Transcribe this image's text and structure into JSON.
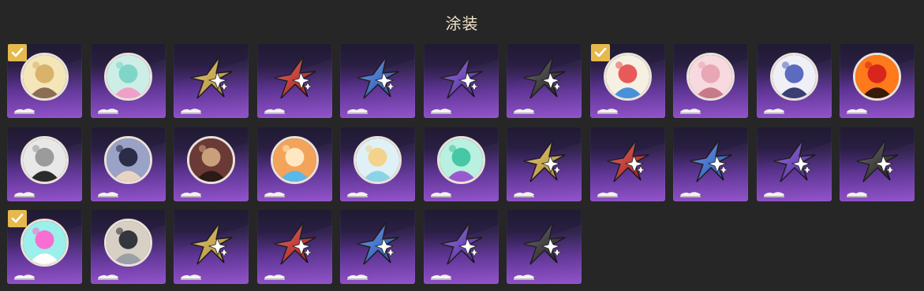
{
  "page": {
    "title": "涂装"
  },
  "colors": {
    "background": "#262626",
    "title": "#f0e3c8",
    "check_badge": "#e6b94c",
    "gold": "#e8b93f",
    "red": "#e0261f",
    "blue": "#2f72ea",
    "purple": "#6a34d4",
    "black": "#2a2a2a"
  },
  "skins": [
    {
      "name": "skin-avatar-girl-sketch",
      "kind": "avatar",
      "palette": [
        "#f4e6b8",
        "#d9b36b",
        "#8a6d53"
      ],
      "equipped": true
    },
    {
      "name": "skin-avatar-teal-swirl",
      "kind": "avatar",
      "palette": [
        "#cdeee6",
        "#7fd6c8",
        "#f0a0c8"
      ],
      "equipped": false
    },
    {
      "name": "skin-star-gold",
      "kind": "star",
      "color": "#e8b93f",
      "equipped": false
    },
    {
      "name": "skin-star-red",
      "kind": "star",
      "color": "#e0261f",
      "equipped": false
    },
    {
      "name": "skin-star-blue",
      "kind": "star",
      "color": "#2f72ea",
      "equipped": false
    },
    {
      "name": "skin-star-purple",
      "kind": "star",
      "color": "#6a34d4",
      "equipped": false
    },
    {
      "name": "skin-star-black",
      "kind": "star",
      "color": "#2a2a2a",
      "equipped": false
    },
    {
      "name": "skin-avatar-sticker-collage",
      "kind": "avatar",
      "palette": [
        "#f6f0e2",
        "#e85a5a",
        "#4a90d9"
      ],
      "equipped": true
    },
    {
      "name": "skin-avatar-pink-sketch",
      "kind": "avatar",
      "palette": [
        "#f7d9df",
        "#e8a7b4",
        "#c77a8a"
      ],
      "equipped": false
    },
    {
      "name": "skin-avatar-emblem-crest",
      "kind": "avatar",
      "palette": [
        "#eef0f6",
        "#5c6bc0",
        "#3a3f73"
      ],
      "equipped": false
    },
    {
      "name": "skin-avatar-red-creature",
      "kind": "avatar",
      "palette": [
        "#ff7a1a",
        "#d8261c",
        "#3a1a0a"
      ],
      "equipped": false
    },
    {
      "name": "skin-avatar-masked-hunter",
      "kind": "avatar",
      "palette": [
        "#e8e8e8",
        "#9b9b9b",
        "#2b2b2b"
      ],
      "equipped": false
    },
    {
      "name": "skin-avatar-dark-hair-boy",
      "kind": "avatar",
      "palette": [
        "#9aa2c7",
        "#2a2d45",
        "#e9d4c3"
      ],
      "equipped": false
    },
    {
      "name": "skin-avatar-two-girls",
      "kind": "avatar",
      "palette": [
        "#6b3a36",
        "#c9a07a",
        "#2a1a18"
      ],
      "equipped": false
    },
    {
      "name": "skin-avatar-orange-crystal",
      "kind": "avatar",
      "palette": [
        "#f3a35a",
        "#ffe7c2",
        "#59b9e8"
      ],
      "equipped": false
    },
    {
      "name": "skin-avatar-blonde-chibi",
      "kind": "avatar",
      "palette": [
        "#dff1f7",
        "#f3d38a",
        "#8bd3e8"
      ],
      "equipped": false
    },
    {
      "name": "skin-avatar-mint-gem",
      "kind": "avatar",
      "palette": [
        "#b9f0df",
        "#46c7a5",
        "#9b59d0"
      ],
      "equipped": false
    },
    {
      "name": "skin-star-gold-2",
      "kind": "star",
      "color": "#e8b93f",
      "equipped": false
    },
    {
      "name": "skin-star-red-2",
      "kind": "star",
      "color": "#e0261f",
      "equipped": false
    },
    {
      "name": "skin-star-blue-2",
      "kind": "star",
      "color": "#2f72ea",
      "equipped": false
    },
    {
      "name": "skin-star-purple-2",
      "kind": "star",
      "color": "#6a34d4",
      "equipped": false
    },
    {
      "name": "skin-star-black-2",
      "kind": "star",
      "color": "#2a2a2a",
      "equipped": false
    },
    {
      "name": "skin-avatar-pink-cat",
      "kind": "avatar",
      "palette": [
        "#9af0ea",
        "#f86ed2",
        "#ffffff"
      ],
      "equipped": true
    },
    {
      "name": "skin-avatar-dark-coat-boy",
      "kind": "avatar",
      "palette": [
        "#d8d0c4",
        "#33363d",
        "#9aa0a6"
      ],
      "equipped": false
    },
    {
      "name": "skin-star-gold-3",
      "kind": "star",
      "color": "#e8b93f",
      "equipped": false
    },
    {
      "name": "skin-star-red-3",
      "kind": "star",
      "color": "#e0261f",
      "equipped": false
    },
    {
      "name": "skin-star-blue-3",
      "kind": "star",
      "color": "#2f72ea",
      "equipped": false
    },
    {
      "name": "skin-star-purple-3",
      "kind": "star",
      "color": "#6a34d4",
      "equipped": false
    },
    {
      "name": "skin-star-black-3",
      "kind": "star",
      "color": "#2a2a2a",
      "equipped": false
    }
  ]
}
